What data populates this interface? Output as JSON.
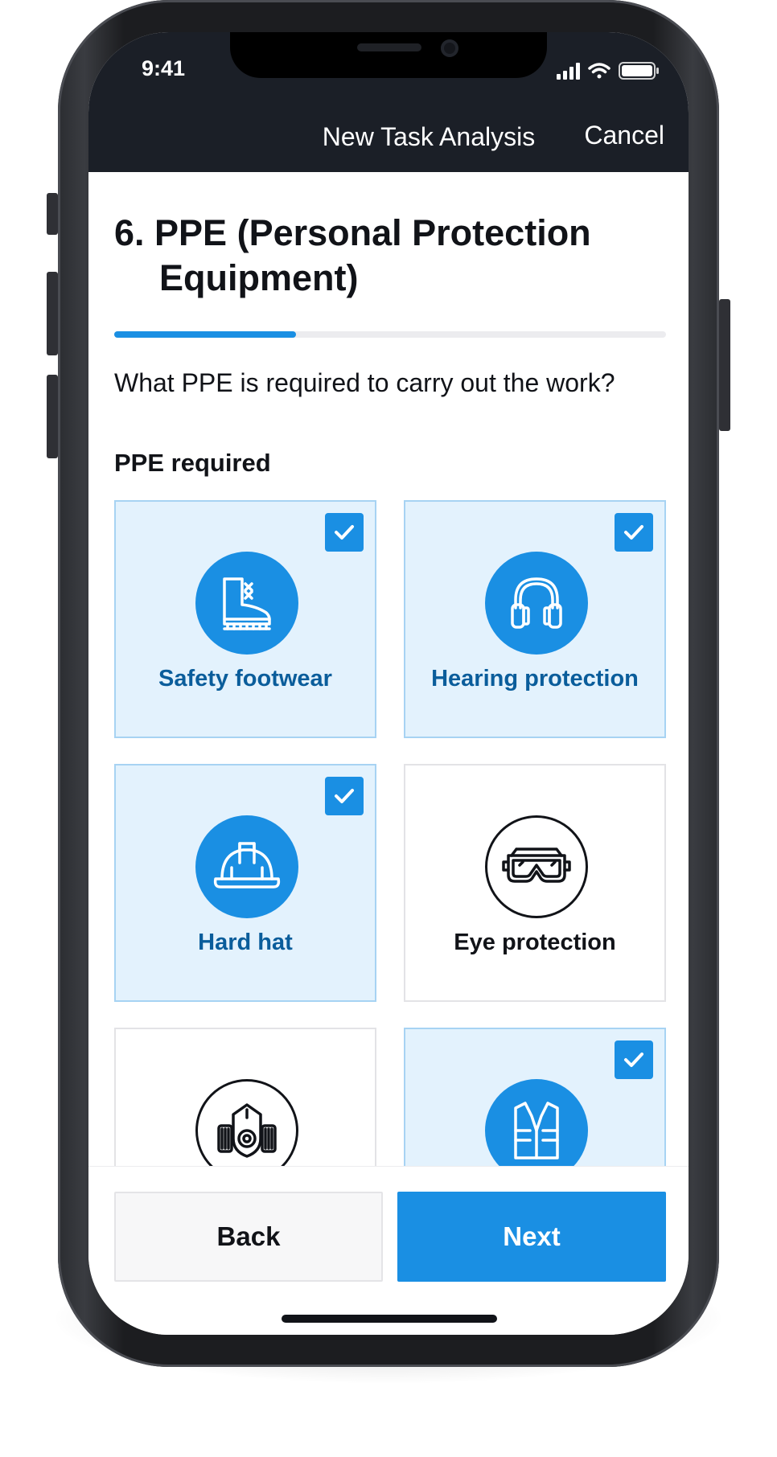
{
  "status_bar": {
    "time": "9:41"
  },
  "nav": {
    "title": "New Task Analysis",
    "cancel_label": "Cancel"
  },
  "step": {
    "title": "6. PPE (Personal Protection Equipment)",
    "progress_fraction": 0.33,
    "question": "What PPE is required to carry out the work?"
  },
  "ppe_section": {
    "label": "PPE required",
    "items": [
      {
        "label": "Safety footwear",
        "icon": "boot-icon",
        "selected": true
      },
      {
        "label": "Hearing protection",
        "icon": "headphones-icon",
        "selected": true
      },
      {
        "label": "Hard hat",
        "icon": "hard-hat-icon",
        "selected": true
      },
      {
        "label": "Eye protection",
        "icon": "goggles-icon",
        "selected": false
      },
      {
        "label": "",
        "icon": "respirator-icon",
        "selected": false
      },
      {
        "label": "",
        "icon": "hi-vis-vest-icon",
        "selected": true
      }
    ]
  },
  "footer": {
    "back_label": "Back",
    "next_label": "Next"
  },
  "colors": {
    "accent": "#1a8fe3",
    "selected_bg": "#e3f2fd",
    "selected_text": "#0a5d9b",
    "nav_bg": "#1b1f27"
  }
}
